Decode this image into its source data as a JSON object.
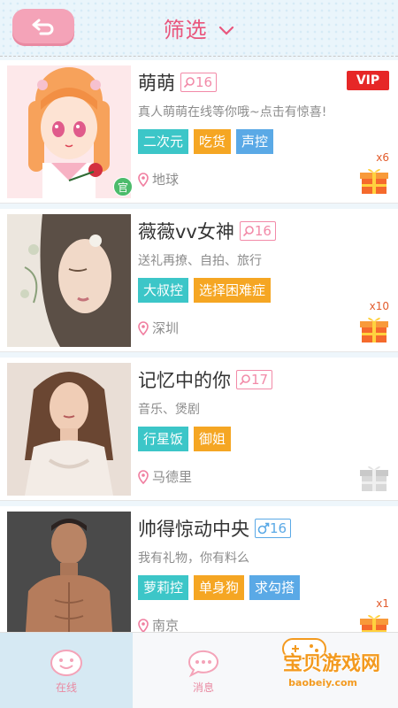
{
  "header": {
    "title": "筛选"
  },
  "cards": [
    {
      "name": "萌萌",
      "age": "16",
      "gender": "female",
      "description": "真人萌萌在线等你哦~点击有惊喜!",
      "tags": [
        {
          "label": "二次元",
          "color": "#3cc6c8"
        },
        {
          "label": "吃货",
          "color": "#f5a623"
        },
        {
          "label": "声控",
          "color": "#5aa9e6"
        }
      ],
      "location": "地球",
      "vip": "VIP",
      "official": "官",
      "gift_count": "x6"
    },
    {
      "name": "薇薇vv女神",
      "age": "16",
      "gender": "female",
      "description": "送礼再撩、自拍、旅行",
      "tags": [
        {
          "label": "大叔控",
          "color": "#3cc6c8"
        },
        {
          "label": "选择困难症",
          "color": "#f5a623"
        }
      ],
      "location": "深圳",
      "gift_count": "x10"
    },
    {
      "name": "记忆中的你",
      "age": "17",
      "gender": "female",
      "description": "音乐、煲剧",
      "tags": [
        {
          "label": "行星饭",
          "color": "#3cc6c8"
        },
        {
          "label": "御姐",
          "color": "#f5a623"
        }
      ],
      "location": "马德里",
      "gift_count": ""
    },
    {
      "name": "帅得惊动中央",
      "age": "16",
      "gender": "male",
      "description": "我有礼物，你有料么",
      "tags": [
        {
          "label": "萝莉控",
          "color": "#3cc6c8"
        },
        {
          "label": "单身狗",
          "color": "#f5a623"
        },
        {
          "label": "求勾搭",
          "color": "#5aa9e6"
        }
      ],
      "location": "南京",
      "gift_count": "x1"
    }
  ],
  "nav": {
    "online": "在线",
    "messages": "消息"
  },
  "watermark": {
    "text": "宝贝游戏网",
    "url": "baobeiy.com"
  },
  "colors": {
    "accent_pink": "#e9557c",
    "tag_teal": "#3cc6c8",
    "tag_orange": "#f5a623",
    "tag_blue": "#5aa9e6",
    "vip_red": "#e62727"
  }
}
